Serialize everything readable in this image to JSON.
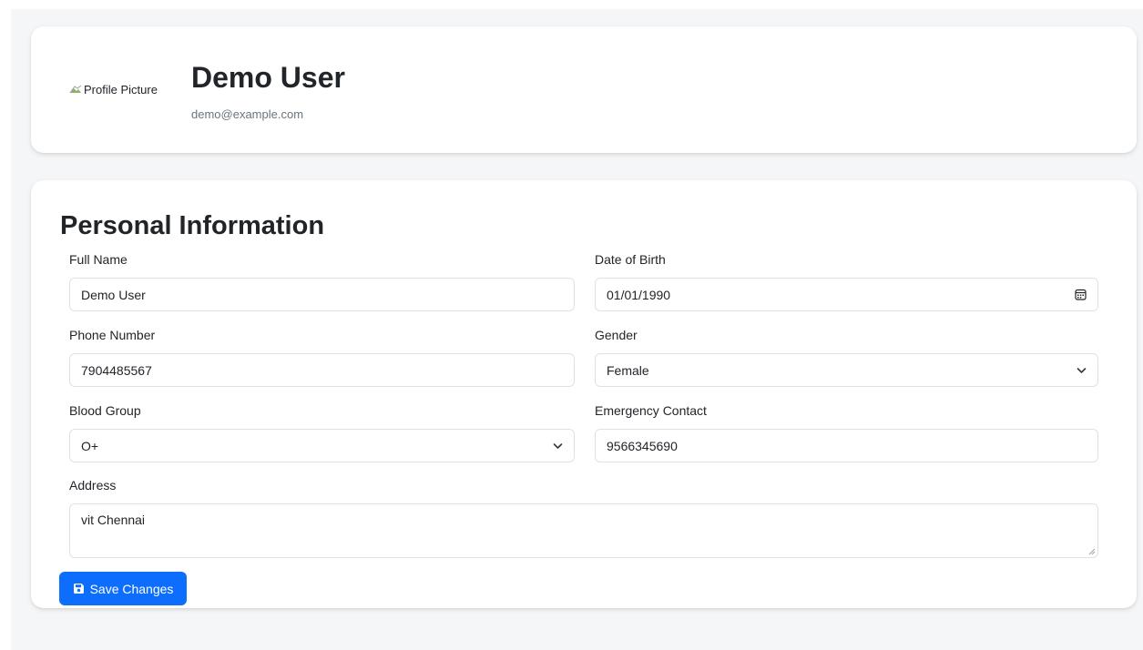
{
  "profile": {
    "picture_alt": "Profile Picture",
    "name": "Demo User",
    "email": "demo@example.com"
  },
  "personal_info": {
    "title": "Personal Information",
    "full_name": {
      "label": "Full Name",
      "value": "Demo User"
    },
    "date_of_birth": {
      "label": "Date of Birth",
      "value": "01/01/1990"
    },
    "phone_number": {
      "label": "Phone Number",
      "value": "7904485567"
    },
    "gender": {
      "label": "Gender",
      "value": "Female"
    },
    "blood_group": {
      "label": "Blood Group",
      "value": "O+"
    },
    "emergency_contact": {
      "label": "Emergency Contact",
      "value": "9566345690"
    },
    "address": {
      "label": "Address",
      "value": "vit Chennai"
    },
    "save_label": "Save Changes"
  },
  "icons": {
    "calendar": "calendar-icon",
    "chevron": "chevron-down-icon",
    "save": "floppy-disk-icon",
    "broken_image": "broken-image-icon"
  },
  "colors": {
    "primary": "#0d6efd",
    "page_background": "#f5f6f8",
    "muted_text": "#6c757d",
    "border": "#dee2e6"
  }
}
